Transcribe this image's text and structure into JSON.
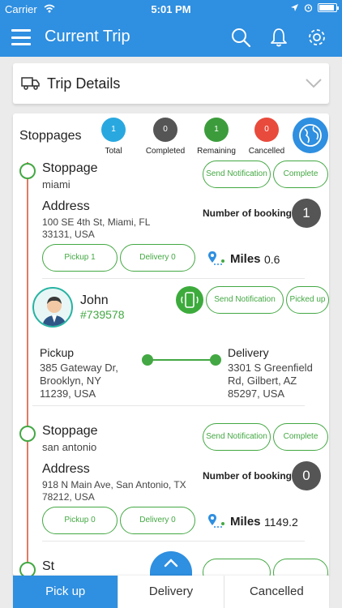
{
  "status_bar": {
    "carrier": "Carrier",
    "time": "5:01 PM"
  },
  "header": {
    "title": "Current Trip"
  },
  "trip_details": {
    "label": "Trip Details"
  },
  "stoppages": {
    "title": "Stoppages",
    "stats": [
      {
        "label": "Total",
        "count": "1",
        "color": "#29a8e0"
      },
      {
        "label": "Completed",
        "count": "0",
        "color": "#555555"
      },
      {
        "label": "Remaining",
        "count": "1",
        "color": "#3c9c3c"
      },
      {
        "label": "Cancelled",
        "count": "0",
        "color": "#e84a3c"
      }
    ],
    "items": [
      {
        "heading": "Stoppage",
        "city": "miami",
        "send_notification_label": "Send Notification",
        "complete_label": "Complete",
        "address_label": "Address",
        "address": [
          "100 SE 4th St, Miami, FL",
          "33131, USA"
        ],
        "booking_label": "Number of booking",
        "booking_count": "1",
        "pickup_label": "Pickup 1",
        "delivery_label": "Delivery 0",
        "miles_label": "Miles",
        "miles_value": "0.6"
      },
      {
        "heading": "Stoppage",
        "city": "san antonio",
        "send_notification_label": "Send Notification",
        "complete_label": "Complete",
        "address_label": "Address",
        "address": [
          "918 N Main Ave, San Antonio, TX",
          "78212, USA"
        ],
        "booking_label": "Number of booking",
        "booking_count": "0",
        "pickup_label": "Pickup 0",
        "delivery_label": "Delivery 0",
        "miles_label": "Miles",
        "miles_value": "1149.2"
      }
    ],
    "partial_heading": "St"
  },
  "customer": {
    "name": "John",
    "booking_id": "#739578",
    "send_notification_label": "Send Notification",
    "picked_up_label": "Picked up",
    "pickup_label": "Pickup",
    "pickup_address": [
      "385 Gateway Dr,",
      "Brooklyn, NY",
      "11239, USA"
    ],
    "delivery_label": "Delivery",
    "delivery_address": [
      "3301 S Greenfield",
      "Rd, Gilbert, AZ",
      "85297, USA"
    ]
  },
  "tabs": [
    {
      "label": "Pick up",
      "active": true
    },
    {
      "label": "Delivery",
      "active": false
    },
    {
      "label": "Cancelled",
      "active": false
    }
  ],
  "colors": {
    "primary": "#2f8fe0",
    "green": "#43a843",
    "timeline": "#e07a63"
  }
}
